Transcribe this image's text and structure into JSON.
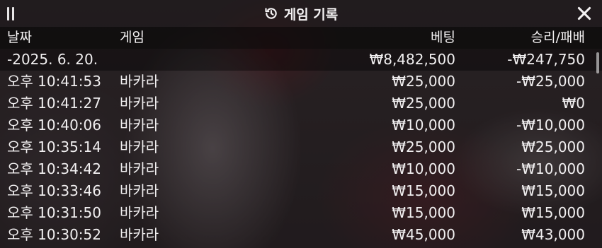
{
  "window": {
    "title": "게임 기록"
  },
  "columns": {
    "date": "날짜",
    "game": "게임",
    "bet": "베팅",
    "win_loss": "승리/패배"
  },
  "summary": {
    "date": "-2025. 6. 20.",
    "bet": "₩8,482,500",
    "win_loss": "-₩247,750"
  },
  "rows": [
    {
      "time": "오후 10:41:53",
      "game": "바카라",
      "bet": "₩25,000",
      "win_loss": "-₩25,000"
    },
    {
      "time": "오후 10:41:27",
      "game": "바카라",
      "bet": "₩25,000",
      "win_loss": "₩0"
    },
    {
      "time": "오후 10:40:06",
      "game": "바카라",
      "bet": "₩10,000",
      "win_loss": "-₩10,000"
    },
    {
      "time": "오후 10:35:14",
      "game": "바카라",
      "bet": "₩25,000",
      "win_loss": "₩25,000"
    },
    {
      "time": "오후 10:34:42",
      "game": "바카라",
      "bet": "₩10,000",
      "win_loss": "-₩10,000"
    },
    {
      "time": "오후 10:33:46",
      "game": "바카라",
      "bet": "₩15,000",
      "win_loss": "₩15,000"
    },
    {
      "time": "오후 10:31:50",
      "game": "바카라",
      "bet": "₩15,000",
      "win_loss": "₩15,000"
    },
    {
      "time": "오후 10:30:52",
      "game": "바카라",
      "bet": "₩45,000",
      "win_loss": "₩43,000"
    }
  ],
  "icons": {
    "menu": "menu-icon",
    "history": "history-icon",
    "close": "close-icon"
  }
}
